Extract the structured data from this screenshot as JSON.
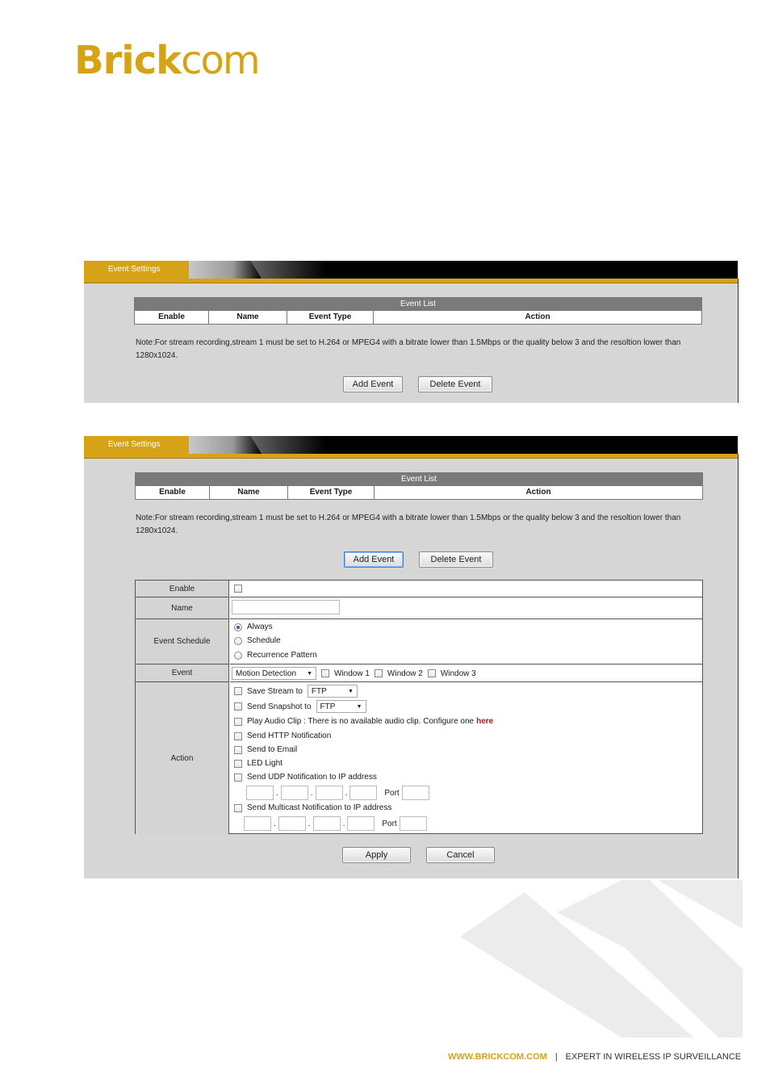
{
  "brand": {
    "logo_bold": "Brick",
    "logo_light": "com"
  },
  "panels": [
    {
      "tab_label": "Event Settings",
      "list_title": "Event List",
      "columns": [
        "Enable",
        "Name",
        "Event Type",
        "Action"
      ],
      "note": "Note:For stream recording,stream 1 must be set to H.264 or MPEG4 with a bitrate lower than 1.5Mbps or the quality below 3 and the resoltion lower than 1280x1024.",
      "add_label": "Add Event",
      "delete_label": "Delete Event"
    },
    {
      "tab_label": "Event Settings",
      "list_title": "Event List",
      "columns": [
        "Enable",
        "Name",
        "Event Type",
        "Action"
      ],
      "note": "Note:For stream recording,stream 1 must be set to H.264 or MPEG4 with a bitrate lower than 1.5Mbps or the quality below 3 and the resoltion lower than 1280x1024.",
      "add_label": "Add Event",
      "delete_label": "Delete Event"
    }
  ],
  "form": {
    "enable_label": "Enable",
    "name_label": "Name",
    "name_value": "",
    "schedule_label": "Event Schedule",
    "schedule_options": [
      "Always",
      "Schedule",
      "Recurrence Pattern"
    ],
    "schedule_selected": "Always",
    "event_label": "Event",
    "event_type": "Motion Detection",
    "windows": [
      "Window 1",
      "Window 2",
      "Window 3"
    ],
    "action_label": "Action",
    "save_stream_label": "Save Stream to",
    "save_stream_target": "FTP",
    "send_snapshot_label": "Send Snapshot to",
    "send_snapshot_target": "FTP",
    "play_audio_text": "Play Audio Clip : There is no available audio clip. Configure one",
    "play_audio_link": "here",
    "send_http": "Send HTTP Notification",
    "send_email": "Send to Email",
    "led_light": "LED Light",
    "send_udp": "Send UDP Notification to IP address",
    "send_multicast": "Send Multicast Notification to IP address",
    "ip_sep": ".",
    "port_label": "Port",
    "apply_label": "Apply",
    "cancel_label": "Cancel"
  },
  "footer": {
    "url": "WWW.BRICKCOM.COM",
    "separator": "|",
    "tagline": "EXPERT IN WIRELESS IP SURVEILLANCE"
  },
  "colors": {
    "brand_gold": "#d6a316",
    "panel_gray": "#d6d6d6",
    "link_red": "#b5121b"
  }
}
